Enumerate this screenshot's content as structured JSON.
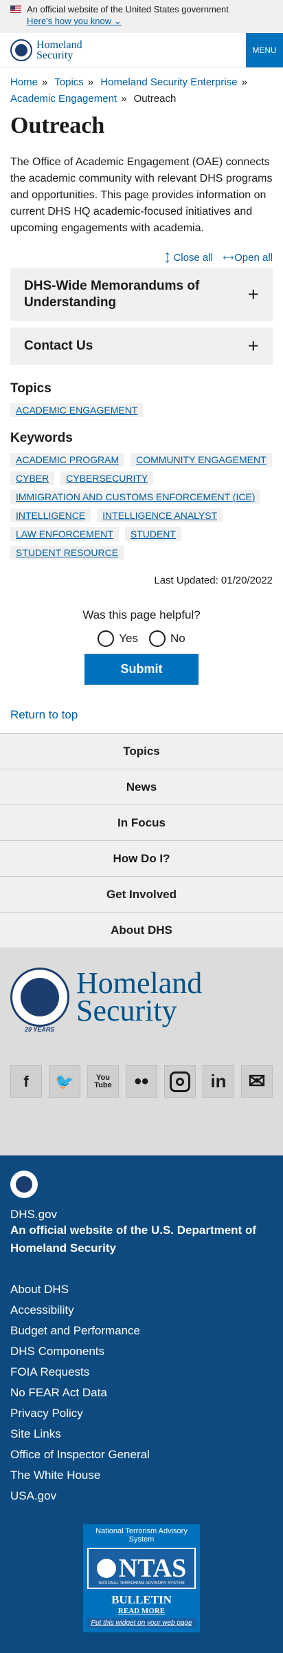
{
  "banner": {
    "official": "An official website of the United States government",
    "how": "Here's how you know"
  },
  "header": {
    "logo_line1": "Homeland",
    "logo_line2": "Security",
    "menu": "MENU"
  },
  "breadcrumb": {
    "home": "Home",
    "topics": "Topics",
    "hse": "Homeland Security Enterprise",
    "ae": "Academic Engagement",
    "current": "Outreach",
    "sep": "»"
  },
  "page": {
    "title": "Outreach",
    "intro": "The Office of Academic Engagement (OAE) connects the academic community with relevant DHS programs and opportunities. This page provides information on current DHS HQ academic-focused initiatives and upcoming engagements with academia.",
    "close_all": "Close all",
    "open_all": "Open all",
    "accordions": [
      "DHS-Wide Memorandums of Understanding",
      "Contact Us"
    ],
    "topics_heading": "Topics",
    "topics": [
      "ACADEMIC ENGAGEMENT"
    ],
    "keywords_heading": "Keywords",
    "keywords": [
      "ACADEMIC PROGRAM",
      "COMMUNITY ENGAGEMENT",
      "CYBER",
      "CYBERSECURITY",
      "IMMIGRATION AND CUSTOMS ENFORCEMENT (ICE)",
      "INTELLIGENCE",
      "INTELLIGENCE ANALYST",
      "LAW ENFORCEMENT",
      "STUDENT",
      "STUDENT RESOURCE"
    ],
    "last_updated": "Last Updated: 01/20/2022"
  },
  "feedback": {
    "question": "Was this page helpful?",
    "yes": "Yes",
    "no": "No",
    "submit": "Submit"
  },
  "return_top": "Return to top",
  "footer_nav": [
    "Topics",
    "News",
    "In Focus",
    "How Do I?",
    "Get Involved",
    "About DHS"
  ],
  "footer_brand": {
    "line1": "Homeland",
    "line2": "Security",
    "years": "20 YEARS"
  },
  "social": [
    "f",
    "t",
    "You Tube",
    "flickr",
    "instagram",
    "in",
    "email"
  ],
  "footer_dark": {
    "site": "DHS.gov",
    "official_prefix": "An official website of the ",
    "official_link": "U.S. Department of Homeland Security",
    "links": [
      "About DHS",
      "Accessibility",
      "Budget and Performance",
      "DHS Components",
      "FOIA Requests",
      "No FEAR Act Data",
      "Privacy Policy",
      "Site Links",
      "Office of Inspector General",
      "The White House",
      "USA.gov"
    ]
  },
  "ntas": {
    "title": "National Terrorism Advisory System",
    "big": "NTAS",
    "sub": "NATIONAL TERRORISM ADVISORY SYSTEM",
    "bulletin": "BULLETIN",
    "read": "READ MORE",
    "put": "Put this widget on your web page"
  }
}
